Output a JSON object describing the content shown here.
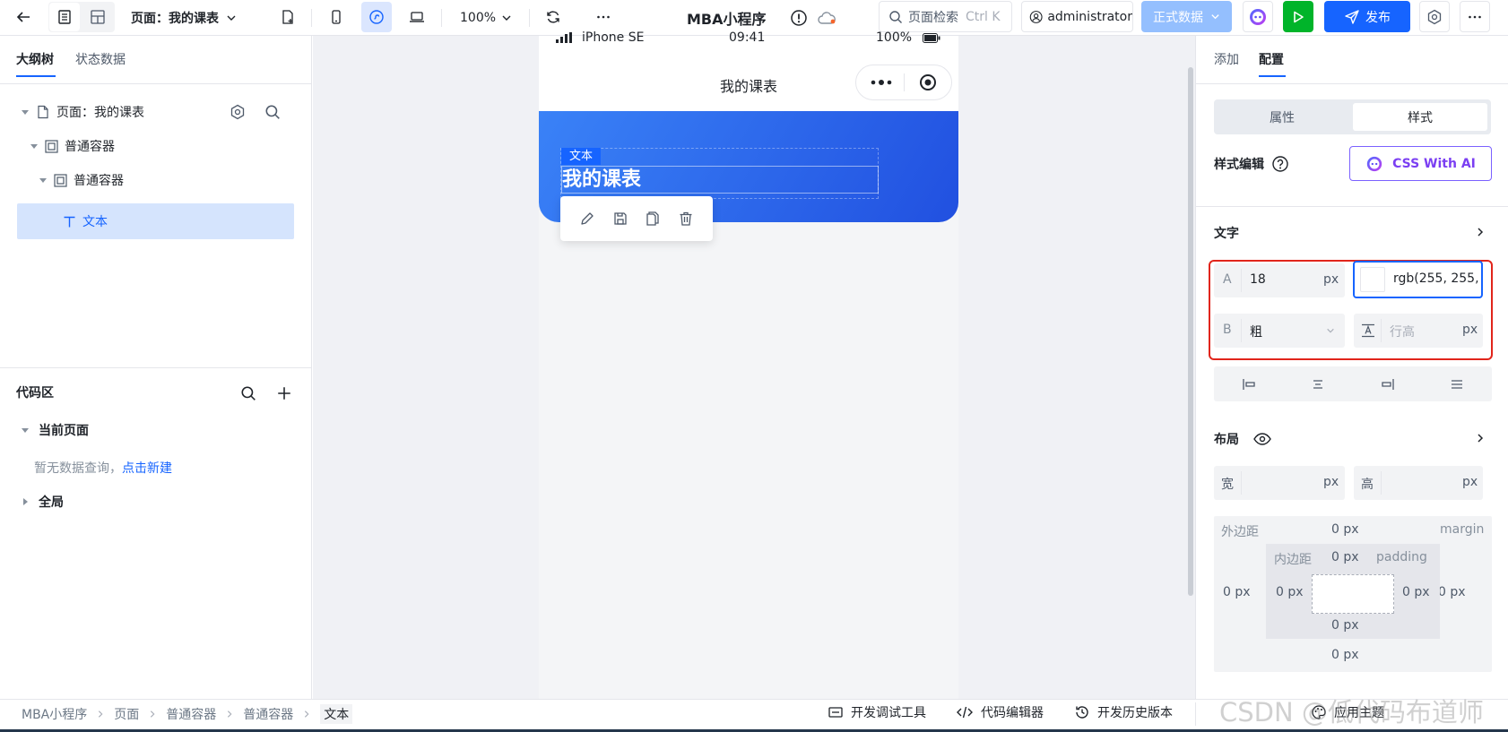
{
  "topbar": {
    "page_selector": "页面：我的课表",
    "zoom": "100%",
    "app_title": "MBA小程序",
    "search_label": "页面检索",
    "search_shortcut": "Ctrl K",
    "user": "administrator",
    "env_label": "正式数据",
    "publish_label": "发布"
  },
  "left": {
    "tabs": [
      "大纲树",
      "状态数据"
    ],
    "tree": [
      {
        "label": "页面：我的课表"
      },
      {
        "label": "普通容器"
      },
      {
        "label": "普通容器"
      },
      {
        "label": "文本"
      }
    ],
    "code_area": {
      "title": "代码区",
      "current_page": "当前页面",
      "empty_text": "暂无数据查询，",
      "create_link": "点击新建",
      "global": "全局"
    }
  },
  "phone": {
    "device": "iPhone SE",
    "time": "09:41",
    "battery": "100%",
    "nav_title": "我的课表",
    "badge": "文本",
    "heading": "我的课表"
  },
  "right": {
    "tabs": [
      "添加",
      "配置"
    ],
    "seg": [
      "属性",
      "样式"
    ],
    "style_edit": "样式编辑",
    "ai_button": "CSS With AI",
    "text_section": "文字",
    "font_size_prefix": "A",
    "font_size": "18",
    "unit": "px",
    "color_value": "rgb(255, 255,",
    "weight_prefix": "B",
    "weight": "粗",
    "line_height_placeholder": "行高",
    "layout_section": "布局",
    "width_label": "宽",
    "height_label": "高",
    "margin_label": "外边距",
    "margin_en": "margin",
    "padding_label": "内边距",
    "padding_en": "padding",
    "box_values": {
      "margin_top": "0 px",
      "margin_left": "0 px",
      "margin_right": "0 px",
      "margin_bottom": "0 px",
      "padding_top": "0 px",
      "padding_left": "0 px",
      "padding_right": "0 px",
      "padding_bottom": "0 px"
    }
  },
  "breadcrumb": [
    "MBA小程序",
    "页面",
    "普通容器",
    "普通容器",
    "文本"
  ],
  "bottom_tools": [
    "开发调试工具",
    "代码编辑器",
    "开发历史版本",
    "应用主题"
  ],
  "watermark": "CSDN @低代码布道师",
  "colors": {
    "accent": "#1664ff",
    "phone_grad_start": "#3a82f7",
    "phone_grad_end": "#2150e0",
    "highlight_border": "#e1251b"
  }
}
